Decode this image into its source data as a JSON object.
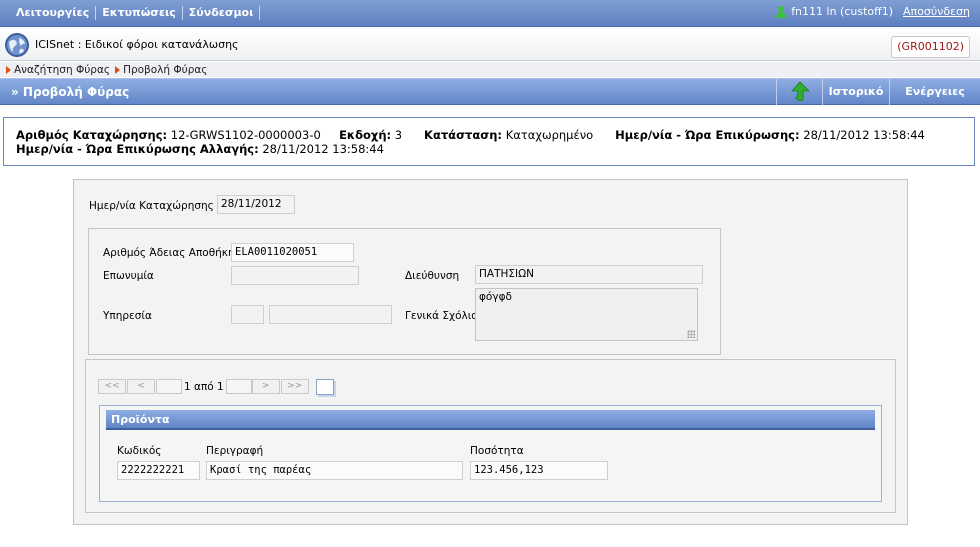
{
  "menu": {
    "items": [
      "Λειτουργίες",
      "Εκτυπώσεις",
      "Σύνδεσμοι"
    ],
    "user": "fn111 ln (custoff1)",
    "logout": "Αποσύνδεση"
  },
  "app": {
    "title": "ICISnet : Ειδικοί φόροι κατανάλωσης",
    "code": "(GR001102)"
  },
  "breadcrumb": [
    "Αναζήτηση Φύρας",
    "Προβολή Φύρας"
  ],
  "page": {
    "title": "» Προβολή Φύρας",
    "history": "Ιστορικό",
    "actions": "Ενέργειες"
  },
  "info": {
    "reg_label": "Αριθμός Καταχώρησης:",
    "reg_value": "12-GRWS1102-0000003-0",
    "version_label": "Εκδοχή:",
    "version_value": "3",
    "status_label": "Κατάσταση:",
    "status_value": "Καταχωρημένο",
    "validation_label": "Ημερ/νία - Ώρα Επικύρωσης:",
    "validation_value": "28/11/2012 13:58:44",
    "change_label": "Ημερ/νία - Ώρα Επικύρωσης Αλλαγής:",
    "change_value": "28/11/2012 13:58:44"
  },
  "form": {
    "reg_date_label": "Ημερ/νία Καταχώρησης",
    "reg_date_value": "28/11/2012",
    "permit_label": "Αριθμός Άδειας Αποθήκης",
    "permit_value": "ELA0011020051",
    "name_label": "Επωνυμία",
    "name_value": "",
    "address_label": "Διεύθυνση",
    "address_value": "ΠΑΤΗΣΙΩΝ",
    "service_label": "Υπηρεσία",
    "service_code": "",
    "service_name": "",
    "comments_label": "Γενικά Σχόλια",
    "comments_value": "φόγφδ"
  },
  "pager": {
    "first": "<<",
    "prev": "<",
    "text": "1 από 1",
    "next": ">",
    "last": ">>"
  },
  "products": {
    "title": "Προϊόντα",
    "columns": [
      "Κωδικός",
      "Περιγραφή",
      "Ποσότητα"
    ],
    "rows": [
      {
        "code": "2222222221",
        "description": "Κρασί της παρέας",
        "quantity": "123.456,123"
      }
    ]
  }
}
